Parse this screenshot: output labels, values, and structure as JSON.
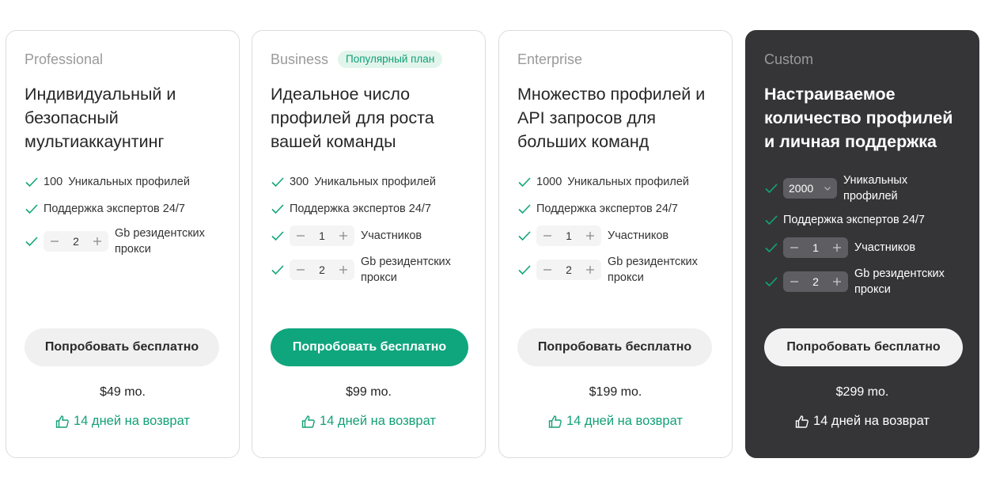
{
  "shared": {
    "cta_label": "Попробовать бесплатно",
    "refund_label": "14 дней на возврат",
    "unique_profiles_label": "Уникальных профилей",
    "support_label": "Поддержка экспертов 24/7",
    "members_label": "Участников",
    "proxy_label": "Gb резидентских прокси"
  },
  "colors": {
    "accent": "#0fa67d",
    "badge_bg": "#e2f5ec",
    "dark_card": "#353538"
  },
  "plans": [
    {
      "name": "Professional",
      "headline": "Индивидуальный и безопасный мультиаккаунтинг",
      "profiles": "100",
      "proxy_gb": "2",
      "price": "$49 mo."
    },
    {
      "name": "Business",
      "badge": "Популярный план",
      "headline": "Идеальное число профилей для роста вашей команды",
      "profiles": "300",
      "members": "1",
      "proxy_gb": "2",
      "price": "$99 mo."
    },
    {
      "name": "Enterprise",
      "headline": "Множество профилей и API запросов для больших команд",
      "profiles": "1000",
      "members": "1",
      "proxy_gb": "2",
      "price": "$199 mo."
    },
    {
      "name": "Custom",
      "headline": "Настраиваемое количество профилей и личная поддержка",
      "profiles": "2000",
      "members": "1",
      "proxy_gb": "2",
      "price": "$299 mo."
    }
  ]
}
